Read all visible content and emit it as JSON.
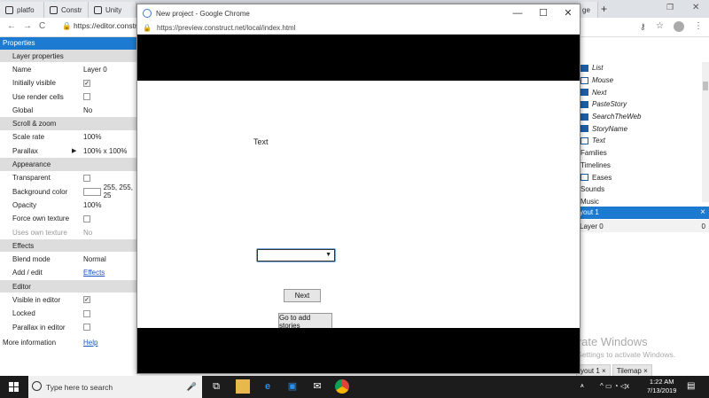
{
  "background_browser": {
    "tabs": [
      "platfo",
      "Constr",
      "Unity"
    ],
    "new_tab_glyph": "+",
    "address": "https://editor.constr",
    "toolbar_glyphs": [
      "←",
      "→",
      "C"
    ]
  },
  "properties": {
    "title": "Properties",
    "rows": [
      {
        "type": "section",
        "label": "Layer properties"
      },
      {
        "label": "Name",
        "value": "Layer 0"
      },
      {
        "label": "Initially visible",
        "check": true
      },
      {
        "label": "Use render cells",
        "check": false
      },
      {
        "label": "Global",
        "value": "No"
      },
      {
        "type": "section",
        "label": "Scroll & zoom"
      },
      {
        "label": "Scale rate",
        "value": "100%"
      },
      {
        "label": "Parallax",
        "value": "100% x 100%",
        "expander": true
      },
      {
        "type": "section",
        "label": "Appearance"
      },
      {
        "label": "Transparent",
        "check": false
      },
      {
        "label": "Background color",
        "value": "255, 255, 25",
        "swatch": true
      },
      {
        "label": "Opacity",
        "value": "100%"
      },
      {
        "label": "Force own texture",
        "check": false
      },
      {
        "label": "Uses own texture",
        "value": "No",
        "dim": true
      },
      {
        "type": "section",
        "label": "Effects"
      },
      {
        "label": "Blend mode",
        "value": "Normal"
      },
      {
        "label": "Add / edit",
        "value": "Effects",
        "link": true
      },
      {
        "type": "section",
        "label": "Editor"
      },
      {
        "label": "Visible in editor",
        "check": true
      },
      {
        "label": "Locked",
        "check": false
      },
      {
        "label": "Parallax in editor",
        "check": false
      }
    ],
    "more_info_label": "More information",
    "more_info_link": "Help"
  },
  "project_tree": {
    "items": [
      {
        "label": "List",
        "italic": true,
        "icon": "list-icon"
      },
      {
        "label": "Mouse",
        "italic": true,
        "icon": "mouse-icon"
      },
      {
        "label": "Next",
        "italic": true,
        "icon": "button-icon"
      },
      {
        "label": "PasteStory",
        "italic": true,
        "icon": "textbox-icon"
      },
      {
        "label": "SearchTheWeb",
        "italic": true,
        "icon": "button-icon"
      },
      {
        "label": "StoryName",
        "italic": true,
        "icon": "textbox-icon"
      },
      {
        "label": "Text",
        "italic": true,
        "icon": "text-icon"
      },
      {
        "label": "Families",
        "italic": false,
        "icon": ""
      },
      {
        "label": "Timelines",
        "italic": false,
        "icon": ""
      },
      {
        "label": "Eases",
        "italic": false,
        "icon": "folder-icon"
      },
      {
        "label": "Sounds",
        "italic": false,
        "icon": ""
      },
      {
        "label": "Music",
        "italic": false,
        "icon": ""
      }
    ]
  },
  "layers_bar": {
    "title": "yout 1",
    "close_glyph": "×",
    "layer_name": "Layer 0",
    "layer_value": "0"
  },
  "editor_tabs": [
    "yout 1 ×",
    "Tilemap ×"
  ],
  "watermark": {
    "line1": "Activate Windows",
    "line2": "Go to Settings to activate Windows."
  },
  "popup": {
    "title": "New project - Google Chrome",
    "url": "https://preview.construct.net/local/index.html",
    "controls": [
      "—",
      "☐",
      "✕"
    ],
    "game": {
      "text_object": "Text",
      "select_value": "",
      "select_arrow": "▼",
      "next_button": "Next",
      "stories_button": "Go to add stories"
    }
  },
  "taskbar": {
    "search_placeholder": "Type here to search",
    "time": "1:22 AM",
    "date": "7/13/2019"
  }
}
